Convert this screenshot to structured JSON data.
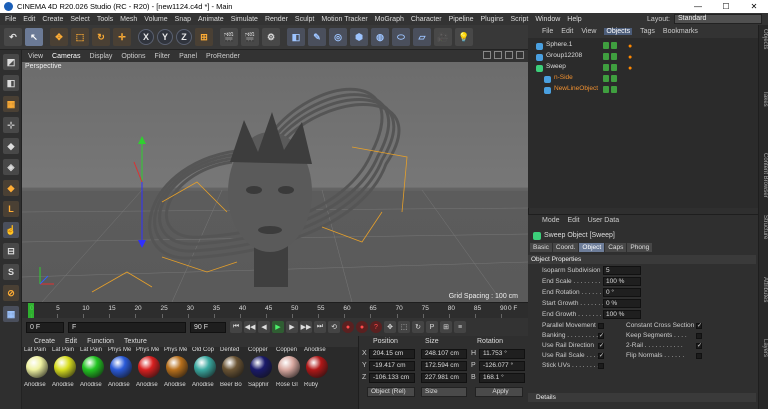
{
  "window": {
    "title": "CINEMA 4D R20.026 Studio (RC - R20) - [new1124.c4d *] - Main",
    "controls": [
      "—",
      "☐",
      "✕"
    ]
  },
  "menubar": {
    "items": [
      "File",
      "Edit",
      "Create",
      "Select",
      "Tools",
      "Mesh",
      "Volume",
      "Snap",
      "Animate",
      "Simulate",
      "Render",
      "Sculpt",
      "Motion Tracker",
      "MoGraph",
      "Character",
      "Pipeline",
      "Plugins",
      "Script",
      "Window",
      "Help"
    ],
    "layout_label": "Layout:",
    "layout_value": "Standard"
  },
  "toolbar": {
    "icons": [
      {
        "name": "undo-icon",
        "glyph": "↶",
        "kind": "gray"
      },
      {
        "name": "select-arrow-icon",
        "glyph": "↖",
        "kind": "sel"
      },
      {
        "name": "move-icon",
        "glyph": "✥",
        "kind": "orange"
      },
      {
        "name": "scale-icon",
        "glyph": "⬚",
        "kind": "orange"
      },
      {
        "name": "rotate-icon",
        "glyph": "↻",
        "kind": "orange"
      },
      {
        "name": "recent-tools-icon",
        "glyph": "✛",
        "kind": "orange"
      },
      {
        "name": "x-axis-icon",
        "glyph": "X",
        "kind": "axis"
      },
      {
        "name": "y-axis-icon",
        "glyph": "Y",
        "kind": "axis"
      },
      {
        "name": "z-axis-icon",
        "glyph": "Z",
        "kind": "axis"
      },
      {
        "name": "coordinate-system-icon",
        "glyph": "⊞",
        "kind": "orange"
      },
      {
        "name": "render-view-icon",
        "glyph": "🎬",
        "kind": "gray"
      },
      {
        "name": "render-picture-viewer-icon",
        "glyph": "🎬",
        "kind": "gray"
      },
      {
        "name": "render-settings-icon",
        "glyph": "⚙",
        "kind": "gray"
      },
      {
        "name": "cube-icon",
        "glyph": "◧",
        "kind": "blue"
      },
      {
        "name": "pen-icon",
        "glyph": "✎",
        "kind": "blue"
      },
      {
        "name": "subdivision-icon",
        "glyph": "◎",
        "kind": "blue"
      },
      {
        "name": "array-icon",
        "glyph": "⬢",
        "kind": "blue"
      },
      {
        "name": "deformer-icon",
        "glyph": "◍",
        "kind": "blue"
      },
      {
        "name": "field-icon",
        "glyph": "⬭",
        "kind": "blue"
      },
      {
        "name": "floor-icon",
        "glyph": "▱",
        "kind": "blue"
      },
      {
        "name": "camera-icon",
        "glyph": "🎥",
        "kind": "gray"
      },
      {
        "name": "light-icon",
        "glyph": "💡",
        "kind": "gray"
      }
    ]
  },
  "lefttools": {
    "icons": [
      {
        "name": "make-editable-icon",
        "glyph": "◩",
        "kind": "gray"
      },
      {
        "name": "model-mode-icon",
        "glyph": "◧",
        "kind": "gray"
      },
      {
        "name": "texture-mode-icon",
        "glyph": "▦",
        "kind": "orange"
      },
      {
        "name": "axis-mode-icon",
        "glyph": "⊹",
        "kind": "gray"
      },
      {
        "name": "points-mode-icon",
        "glyph": "◆",
        "kind": "gray"
      },
      {
        "name": "edges-mode-icon",
        "glyph": "◈",
        "kind": "gray"
      },
      {
        "name": "polygons-mode-icon",
        "glyph": "◆",
        "kind": "orange"
      },
      {
        "name": "enable-axis-icon",
        "glyph": "L",
        "kind": "orange"
      },
      {
        "name": "tweak-mode-icon",
        "glyph": "☝",
        "kind": "blue"
      },
      {
        "name": "viewport-solo-icon",
        "glyph": "⊟",
        "kind": "gray"
      },
      {
        "name": "snap-icon",
        "glyph": "S",
        "kind": "gray"
      },
      {
        "name": "workplane-icon",
        "glyph": "⊘",
        "kind": "orange"
      },
      {
        "name": "lock-workplane-icon",
        "glyph": "▦",
        "kind": "blue"
      }
    ]
  },
  "viewport": {
    "menu": [
      "View",
      "Cameras",
      "Display",
      "Options",
      "Filter",
      "Panel",
      "ProRender"
    ],
    "active_menu": "Cameras",
    "label": "Perspective",
    "grid_spacing": "Grid Spacing : 100 cm"
  },
  "timeline": {
    "ticks": [
      "0",
      "5",
      "10",
      "15",
      "20",
      "25",
      "30",
      "35",
      "40",
      "45",
      "50",
      "55",
      "60",
      "65",
      "70",
      "75",
      "80",
      "85",
      "90"
    ],
    "end_marker": "0 F"
  },
  "playbar": {
    "current_frame": "0 F",
    "start_field": "F",
    "end_field": "90 F",
    "end_frame": "90 F",
    "buttons": [
      {
        "name": "go-to-start-button",
        "glyph": "⏮",
        "kind": ""
      },
      {
        "name": "previous-key-button",
        "glyph": "◀◀",
        "kind": ""
      },
      {
        "name": "previous-frame-button",
        "glyph": "◀",
        "kind": ""
      },
      {
        "name": "play-button",
        "glyph": "▶",
        "kind": "play"
      },
      {
        "name": "next-frame-button",
        "glyph": "▶",
        "kind": ""
      },
      {
        "name": "next-key-button",
        "glyph": "▶▶",
        "kind": ""
      },
      {
        "name": "go-to-end-button",
        "glyph": "⏭",
        "kind": ""
      },
      {
        "name": "loop-button",
        "glyph": "⟲",
        "kind": ""
      },
      {
        "name": "record-active-button",
        "glyph": "●",
        "kind": "rec"
      },
      {
        "name": "autokey-button",
        "glyph": "●",
        "kind": "rec"
      },
      {
        "name": "keyframe-selection-button",
        "glyph": "?",
        "kind": "rec"
      },
      {
        "name": "position-key-button",
        "glyph": "✥",
        "kind": ""
      },
      {
        "name": "scale-key-button",
        "glyph": "⬚",
        "kind": ""
      },
      {
        "name": "rotation-key-button",
        "glyph": "↻",
        "kind": ""
      },
      {
        "name": "parameter-key-button",
        "glyph": "P",
        "kind": ""
      },
      {
        "name": "pla-key-button",
        "glyph": "⊞",
        "kind": ""
      },
      {
        "name": "timeline-button",
        "glyph": "≡",
        "kind": ""
      }
    ]
  },
  "materials": {
    "menu": [
      "Create",
      "Edit",
      "Function",
      "Texture"
    ],
    "items": [
      {
        "top": "Lat Pain",
        "bottom": "Anodise",
        "color": "#eef1a0"
      },
      {
        "top": "Lat Pain",
        "bottom": "Anodise",
        "color": "#d8de20"
      },
      {
        "top": "Lat Pain",
        "bottom": "Anodise",
        "color": "#22c522"
      },
      {
        "top": "Phys Me",
        "bottom": "Anodise",
        "color": "#2a5ad8"
      },
      {
        "top": "Phys Me",
        "bottom": "Anodise",
        "color": "#d82020"
      },
      {
        "top": "Phys Me",
        "bottom": "Anodise",
        "color": "#b8701c"
      },
      {
        "top": "Old Cop",
        "bottom": "Anodise",
        "color": "#3aa9a0"
      },
      {
        "top": "Dented",
        "bottom": "Beer Bo",
        "color": "#6a5434"
      },
      {
        "top": "Copper",
        "bottom": "Sapphir",
        "color": "#1a1a6a"
      },
      {
        "top": "Coppen",
        "bottom": "Rose Gl",
        "color": "#d8a8a0"
      },
      {
        "top": "Anodise",
        "bottom": "Ruby",
        "color": "#b01818"
      }
    ]
  },
  "coordinates": {
    "headers": [
      "Position",
      "Size",
      "Rotation"
    ],
    "rows": [
      {
        "axis": "X",
        "pos": "204.15 cm",
        "size": "248.107 cm",
        "rot_axis": "H",
        "rot": "11.753 °"
      },
      {
        "axis": "Y",
        "pos": "-19.417 cm",
        "size": "172.594 cm",
        "rot_axis": "P",
        "rot": "-126.077 °"
      },
      {
        "axis": "Z",
        "pos": "-106.133 cm",
        "size": "227.981 cm",
        "rot_axis": "B",
        "rot": "168.1 °"
      }
    ],
    "mode": "Object (Rel)",
    "size_mode": "Size",
    "apply": "Apply"
  },
  "objects": {
    "menu": [
      "File",
      "Edit",
      "View",
      "Objects",
      "Tags",
      "Bookmarks"
    ],
    "active_menu": "Objects",
    "items": [
      {
        "name": "Sphere.1",
        "indent": 0,
        "color": "#4aa0e0",
        "textcolor": "#dddddd"
      },
      {
        "name": "Group12208",
        "indent": 0,
        "color": "#4aa0e0",
        "textcolor": "#dddddd"
      },
      {
        "name": "Sweep",
        "indent": 0,
        "color": "#3ccf7a",
        "textcolor": "#dddddd"
      },
      {
        "name": "n-Side",
        "indent": 1,
        "color": "#4aa0e0",
        "textcolor": "#f09030"
      },
      {
        "name": "NewLineObject",
        "indent": 1,
        "color": "#4aa0e0",
        "textcolor": "#f09030"
      }
    ]
  },
  "attributes": {
    "menu": [
      "Mode",
      "Edit",
      "User Data"
    ],
    "object_name": "Sweep Object [Sweep]",
    "tabs": [
      "Basic",
      "Coord.",
      "Object",
      "Caps",
      "Phong"
    ],
    "active_tab": "Object",
    "section": "Object Properties",
    "props": [
      {
        "label": "Isoparm Subdivision",
        "value": "5"
      },
      {
        "label": "End Scale . . . . . . . . .",
        "value": "100 %"
      },
      {
        "label": "End Rotation . . . . . .",
        "value": "0 °"
      },
      {
        "label": "Start Growth . . . . . . .",
        "value": "0 %"
      },
      {
        "label": "End Growth . . . . . . . .",
        "value": "100 %"
      }
    ],
    "checks_left": [
      {
        "label": "Parallel Movement",
        "checked": false
      },
      {
        "label": "Banking . . . . . . . . . .",
        "checked": true
      },
      {
        "label": "Use Rail Direction",
        "checked": true
      },
      {
        "label": "Use Rail Scale . . . .",
        "checked": true
      },
      {
        "label": "Stick UVs . . . . . . . .",
        "checked": false
      }
    ],
    "checks_right": [
      {
        "label": "Constant Cross Section",
        "checked": true
      },
      {
        "label": "Keep Segments . . . .",
        "checked": false
      },
      {
        "label": "2-Rail . . . . . . . . . . .",
        "checked": true
      },
      {
        "label": "Flip Normals . . . . . .",
        "checked": false
      }
    ],
    "details": "Details"
  },
  "side_tabs": [
    "Objects",
    "Takes",
    "Content Browser",
    "Structure",
    "Attributes",
    "Layers"
  ]
}
